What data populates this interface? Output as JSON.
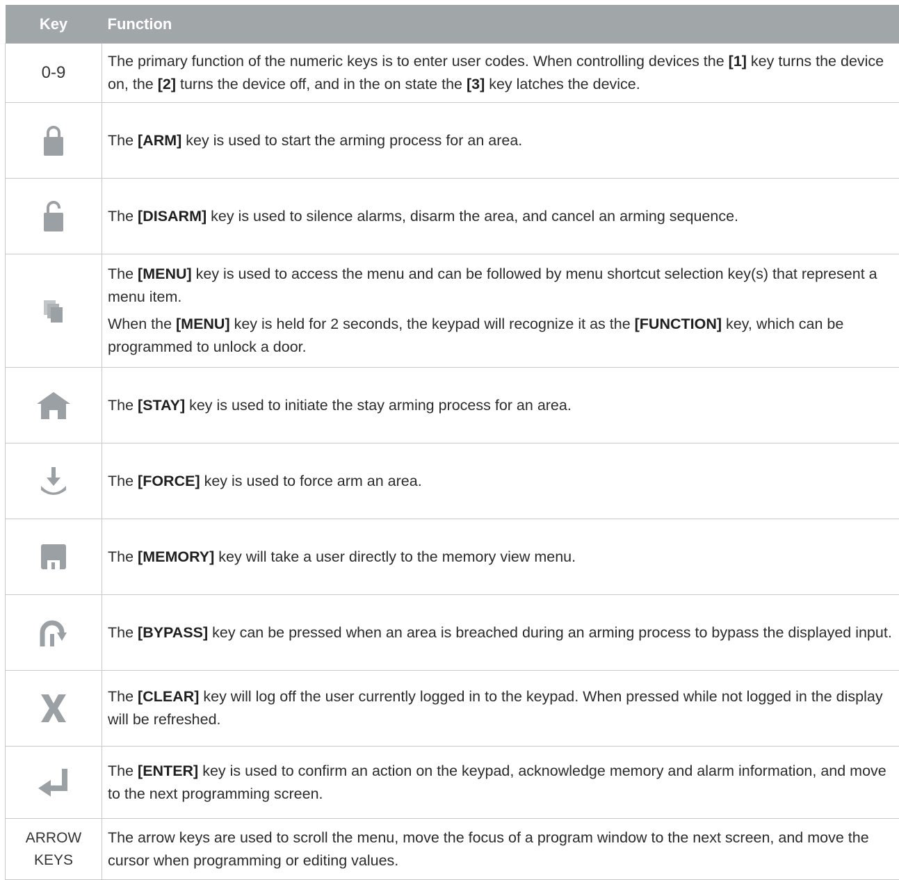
{
  "table": {
    "header": {
      "key": "Key",
      "function": "Function"
    },
    "colors": {
      "header_bg": "#a1a6a9",
      "icon": "#9aa0a4",
      "border": "#c9c9c9"
    },
    "rows": [
      {
        "key_text": "0-9",
        "parts": [
          {
            "t": "The primary function of the numeric keys is to enter user codes. When controlling devices the "
          },
          {
            "t": "[1]",
            "b": true
          },
          {
            "t": " key turns the device on, the "
          },
          {
            "t": "[2]",
            "b": true
          },
          {
            "t": " turns the device off, and in the on state the "
          },
          {
            "t": "[3]",
            "b": true
          },
          {
            "t": " key latches the device."
          }
        ]
      },
      {
        "icon": "lock-closed-icon",
        "parts": [
          {
            "t": "The "
          },
          {
            "t": "[ARM]",
            "b": true
          },
          {
            "t": " key is used to start the arming process for an area."
          }
        ]
      },
      {
        "icon": "lock-open-icon",
        "parts": [
          {
            "t": "The "
          },
          {
            "t": "[DISARM]",
            "b": true
          },
          {
            "t": " key is used to silence alarms, disarm the area, and cancel an arming sequence."
          }
        ]
      },
      {
        "icon": "menu-pages-icon",
        "parts": [
          {
            "t": "The "
          },
          {
            "t": "[MENU]",
            "b": true
          },
          {
            "t": " key is used to access the menu and can be followed by menu shortcut selection key(s) that represent a menu item."
          }
        ],
        "parts2": [
          {
            "t": "When the "
          },
          {
            "t": "[MENU]",
            "b": true
          },
          {
            "t": " key is held for 2 seconds, the keypad will recognize it as the "
          },
          {
            "t": "[FUNCTION]",
            "b": true
          },
          {
            "t": " key, which can be programmed to unlock a door."
          }
        ]
      },
      {
        "icon": "home-icon",
        "parts": [
          {
            "t": "The "
          },
          {
            "t": "[STAY]",
            "b": true
          },
          {
            "t": " key is used to initiate the stay arming process for an area."
          }
        ]
      },
      {
        "icon": "force-arrow-icon",
        "parts": [
          {
            "t": "The "
          },
          {
            "t": "[FORCE]",
            "b": true
          },
          {
            "t": " key is used to force arm an area."
          }
        ]
      },
      {
        "icon": "memory-floppy-icon",
        "parts": [
          {
            "t": "The "
          },
          {
            "t": "[MEMORY]",
            "b": true
          },
          {
            "t": " key will take a user directly to the memory view menu."
          }
        ]
      },
      {
        "icon": "bypass-arrow-icon",
        "parts": [
          {
            "t": "The "
          },
          {
            "t": "[BYPASS]",
            "b": true
          },
          {
            "t": " key can be pressed when an area is breached during an arming process to bypass the displayed input."
          }
        ]
      },
      {
        "icon": "clear-x-icon",
        "parts": [
          {
            "t": "The "
          },
          {
            "t": "[CLEAR]",
            "b": true
          },
          {
            "t": " key will log off the user currently logged in to the keypad. When pressed while not logged in the display will be refreshed."
          }
        ]
      },
      {
        "icon": "enter-arrow-icon",
        "parts": [
          {
            "t": "The "
          },
          {
            "t": "[ENTER]",
            "b": true
          },
          {
            "t": " key is used to confirm an action on the keypad, acknowledge memory and alarm information, and move to the next programming screen."
          }
        ]
      },
      {
        "key_text_lines": [
          "ARROW",
          "KEYS"
        ],
        "parts": [
          {
            "t": "The arrow keys are used to scroll the menu, move the focus of a program window to the next screen, and move the cursor when programming or editing values."
          }
        ]
      }
    ]
  }
}
